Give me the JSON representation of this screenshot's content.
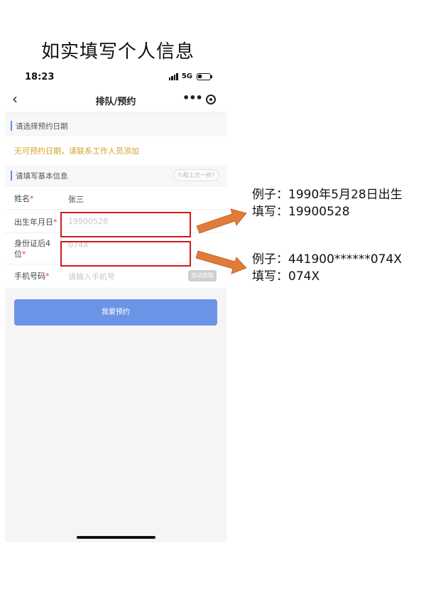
{
  "heading": "如实填写个人信息",
  "status": {
    "time": "18:23",
    "network": "5G"
  },
  "nav": {
    "back_icon": "chevron-left-icon",
    "back_glyph": "‹",
    "title": "排队/预约",
    "more_glyph": "•••"
  },
  "date_section": {
    "title": "请选择预约日期",
    "notice": "无可预约日期，请联系工作人员添加"
  },
  "info_section": {
    "title": "请填写基本信息",
    "prev_button": "↻和上次一样?"
  },
  "form": {
    "name": {
      "label": "姓名",
      "value": "张三"
    },
    "birth": {
      "label": "出生年月日",
      "placeholder": "19900528"
    },
    "id_last4": {
      "label_line1": "身份证后4",
      "label_line2": "位",
      "placeholder": "074X"
    },
    "phone": {
      "label": "手机号码",
      "placeholder": "请输入手机号",
      "auto_button": "自动获取"
    }
  },
  "submit_label": "我要预约",
  "annotations": {
    "birth": {
      "example": "例子：1990年5月28日出生",
      "fill": "填写：19900528"
    },
    "id": {
      "example": "例子：441900******074X",
      "fill": "填写：074X"
    }
  },
  "colors": {
    "accent": "#6b93e6",
    "notice": "#d8a22c",
    "highlight": "#d11a1a",
    "arrow": "#e07b39"
  }
}
